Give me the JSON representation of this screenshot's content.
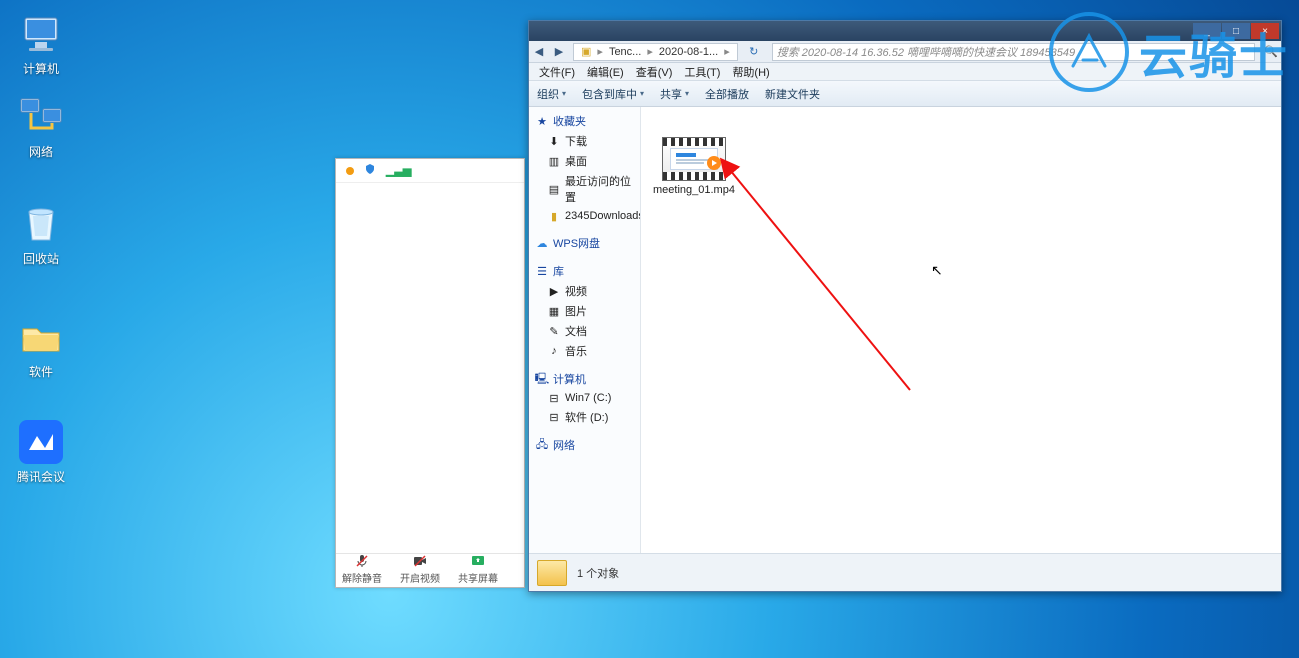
{
  "desktop": {
    "icons": [
      {
        "label": "计算机"
      },
      {
        "label": "网络"
      },
      {
        "label": "回收站"
      },
      {
        "label": "软件"
      },
      {
        "label": "腾讯会议"
      }
    ]
  },
  "meeting_panel": {
    "buttons": [
      {
        "label": "解除静音"
      },
      {
        "label": "开启视频"
      },
      {
        "label": "共享屏幕"
      }
    ]
  },
  "explorer": {
    "window": {
      "min": "_",
      "max": "□",
      "close": "×"
    },
    "nav": {
      "back": "◀",
      "fwd": "▶"
    },
    "breadcrumb": {
      "sep": "▸",
      "parts": [
        "Tenc...",
        "2020-08-1..."
      ]
    },
    "search_placeholder": "搜索 2020-08-14 16.36.52 嘀哩哔嘀嘀的快速会议 189453549",
    "menus": {
      "file": "文件(F)",
      "edit": "编辑(E)",
      "view": "查看(V)",
      "tools": "工具(T)",
      "help": "帮助(H)"
    },
    "toolbar": {
      "org": "组织",
      "lib": "包含到库中",
      "share": "共享",
      "play": "全部播放",
      "new": "新建文件夹",
      "dd": "▾"
    },
    "sidebar": {
      "fav_head": "收藏夹",
      "fav_items": [
        "下载",
        "桌面",
        "最近访问的位置",
        "2345Downloads"
      ],
      "wps": "WPS网盘",
      "lib_head": "库",
      "lib_items": [
        "视频",
        "图片",
        "文档",
        "音乐"
      ],
      "computer_head": "计算机",
      "computer_items": [
        "Win7 (C:)",
        "软件 (D:)"
      ],
      "network": "网络"
    },
    "file": {
      "name": "meeting_01.mp4"
    },
    "status": {
      "count": "1 个对象"
    }
  },
  "watermark": {
    "text": "云骑士"
  }
}
